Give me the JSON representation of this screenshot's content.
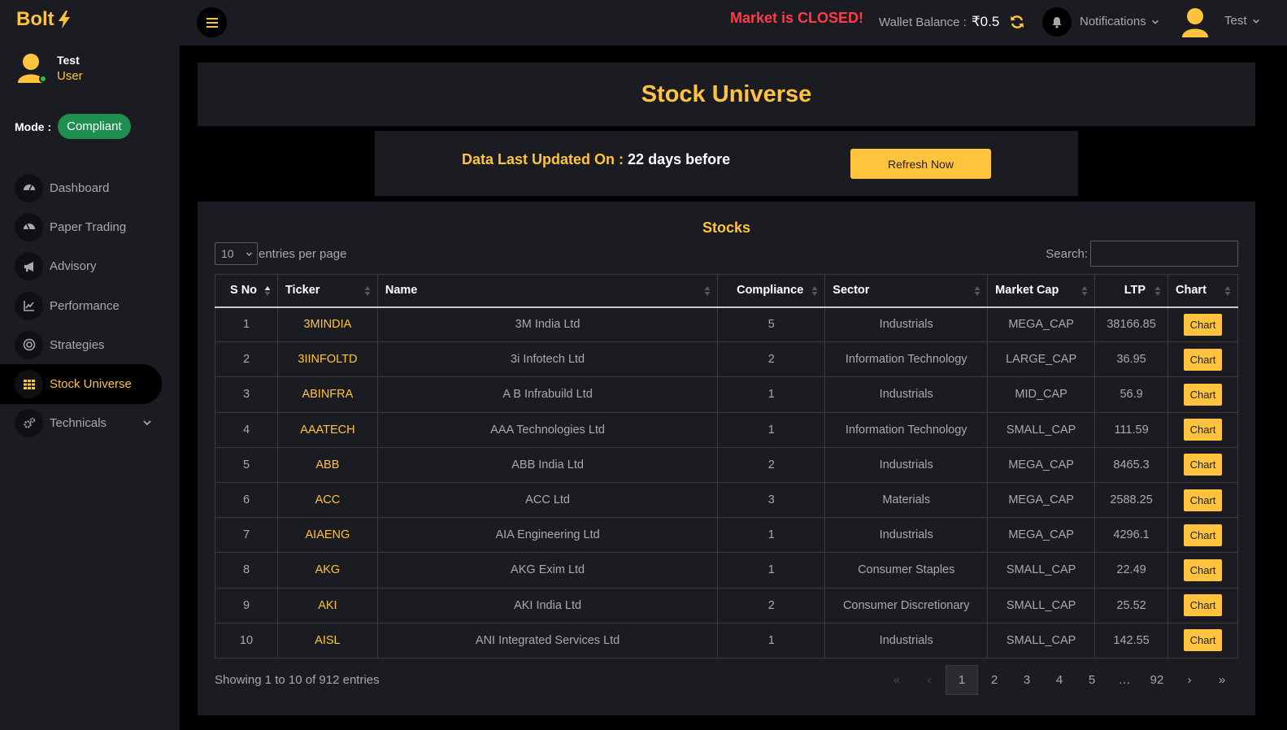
{
  "brand": {
    "name": "Bolt"
  },
  "user": {
    "name": "Test",
    "role": "User"
  },
  "mode": {
    "label": "Mode :",
    "value": "Compliant"
  },
  "sidebar": {
    "items": [
      {
        "label": "Dashboard",
        "icon": "dashboard-icon"
      },
      {
        "label": "Paper Trading",
        "icon": "gauge-icon"
      },
      {
        "label": "Advisory",
        "icon": "megaphone-icon"
      },
      {
        "label": "Performance",
        "icon": "chart-line-icon"
      },
      {
        "label": "Strategies",
        "icon": "target-icon"
      },
      {
        "label": "Stock Universe",
        "icon": "grid-icon"
      },
      {
        "label": "Technicals",
        "icon": "cogs-icon"
      }
    ]
  },
  "topbar": {
    "market_status": "Market is CLOSED!",
    "wallet_label": "Wallet Balance :",
    "wallet_amount": "₹0.5",
    "notifications_label": "Notifications",
    "user_label": "Test"
  },
  "page": {
    "title": "Stock Universe",
    "updated_label": "Data Last Updated On :",
    "updated_value": "22 days before",
    "refresh_label": "Refresh Now"
  },
  "table": {
    "title": "Stocks",
    "page_size": "10",
    "entries_label": "entries per page",
    "search_label": "Search:",
    "columns": [
      "S No",
      "Ticker",
      "Name",
      "Compliance",
      "Sector",
      "Market Cap",
      "LTP",
      "Chart"
    ],
    "rows": [
      [
        "1",
        "3MINDIA",
        "3M India Ltd",
        "5",
        "Industrials",
        "MEGA_CAP",
        "38166.85",
        "Chart"
      ],
      [
        "2",
        "3IINFOLTD",
        "3i Infotech Ltd",
        "2",
        "Information Technology",
        "LARGE_CAP",
        "36.95",
        "Chart"
      ],
      [
        "3",
        "ABINFRA",
        "A B Infrabuild Ltd",
        "1",
        "Industrials",
        "MID_CAP",
        "56.9",
        "Chart"
      ],
      [
        "4",
        "AAATECH",
        "AAA Technologies Ltd",
        "1",
        "Information Technology",
        "SMALL_CAP",
        "111.59",
        "Chart"
      ],
      [
        "5",
        "ABB",
        "ABB India Ltd",
        "2",
        "Industrials",
        "MEGA_CAP",
        "8465.3",
        "Chart"
      ],
      [
        "6",
        "ACC",
        "ACC Ltd",
        "3",
        "Materials",
        "MEGA_CAP",
        "2588.25",
        "Chart"
      ],
      [
        "7",
        "AIAENG",
        "AIA Engineering Ltd",
        "1",
        "Industrials",
        "MEGA_CAP",
        "4296.1",
        "Chart"
      ],
      [
        "8",
        "AKG",
        "AKG Exim Ltd",
        "1",
        "Consumer Staples",
        "SMALL_CAP",
        "22.49",
        "Chart"
      ],
      [
        "9",
        "AKI",
        "AKI India Ltd",
        "2",
        "Consumer Discretionary",
        "SMALL_CAP",
        "25.52",
        "Chart"
      ],
      [
        "10",
        "AISL",
        "ANI Integrated Services Ltd",
        "1",
        "Industrials",
        "SMALL_CAP",
        "142.55",
        "Chart"
      ]
    ],
    "showing": "Showing 1 to 10 of 912 entries",
    "pagination": [
      "«",
      "‹",
      "1",
      "2",
      "3",
      "4",
      "5",
      "…",
      "92",
      "›",
      "»"
    ]
  },
  "colors": {
    "accent": "#ffc33d",
    "danger": "#ff3b4a",
    "success": "#1e8f4e",
    "panel": "#1b1c21"
  }
}
